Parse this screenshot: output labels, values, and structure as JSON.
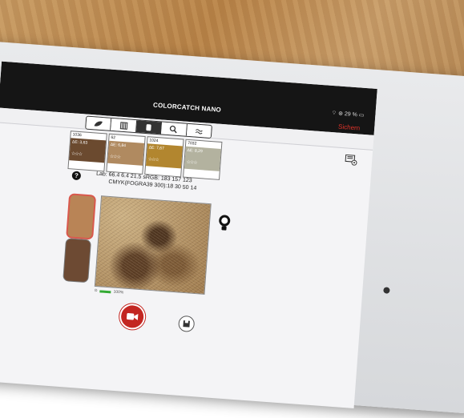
{
  "app": {
    "title": "COLORCATCH NANO",
    "status_text": "29 %",
    "save_label": "Sichern"
  },
  "toolbar": {
    "tabs": [
      "leaf-icon",
      "fan-deck-icon",
      "swatch-icon",
      "search-icon",
      "approx-icon"
    ],
    "active_tab": 2
  },
  "swatches": [
    {
      "code": "1036",
      "de": "ΔE: 3,63",
      "stars": "☆☆☆",
      "color": "#6b4a2f"
    },
    {
      "code": "62",
      "de": "ΔE: 6,84",
      "stars": "☆☆☆",
      "color": "#b08a60"
    },
    {
      "code": "1024",
      "de": "ΔE: 7,67",
      "stars": "☆☆☆",
      "color": "#b2862f"
    },
    {
      "code": "7032",
      "de": "ΔE: 8,29",
      "stars": "☆☆☆",
      "color": "#b3b29f"
    }
  ],
  "readout": {
    "line1": "Lab: 66.4  6.4  21.5  sRGB: 183  157  123",
    "line2": "CMYK(FOGRA39 300):18  30  50  14"
  },
  "camera": {
    "status": "100%"
  },
  "colors": {
    "accent": "#e0332a",
    "record": "#c32621"
  }
}
